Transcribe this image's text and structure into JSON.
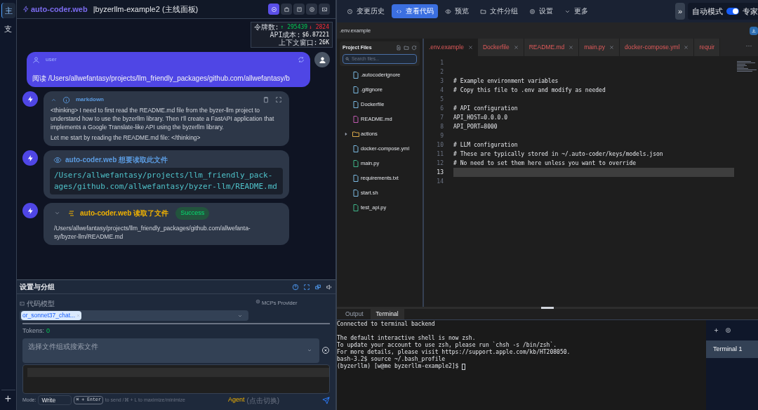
{
  "rail": {
    "items": [
      {
        "label": "主",
        "selected": true
      },
      {
        "label": "支",
        "selected": false
      }
    ],
    "add": "+"
  },
  "header": {
    "brand": "auto-coder.web",
    "project": "|byzerllm-example2 (主线面板)",
    "buttons": [
      {
        "selected": true
      },
      {
        "selected": false
      },
      {
        "selected": false
      },
      {
        "selected": false
      },
      {
        "selected": false
      }
    ]
  },
  "stats": {
    "tokens_label": "令牌数:",
    "tokens_up": "↑ 295439",
    "tokens_down": "↓ 2824",
    "cost_label": "API成本:",
    "cost": "$6.87221",
    "context_label": "上下文窗口:",
    "context": "26K"
  },
  "messages": [
    {
      "kind": "user",
      "role": "user",
      "text": "阅读 /Users/allwefantasy/projects/llm_friendly_packages/github.com/allwefantasy/b"
    },
    {
      "kind": "markdown",
      "label": "markdown",
      "expanded": true,
      "paragraphs": [
        "<thinking> I need to first read the README.md file from the byzer-llm project to understand how to use the byzerllm library. Then I'll create a FastAPI application that implements a Google Translate-like API using the byzerllm library.",
        "Let me start by reading the README.md file: </thinking>"
      ]
    },
    {
      "kind": "read_request",
      "title": "auto-coder.web 想要读取此文件",
      "path_lines": [
        "/Users/allwefantasy/projects/llm_friendly_pack-",
        "ages/github.com/allwefantasy/byzer-llm/README.md"
      ]
    },
    {
      "kind": "read_result",
      "expanded": false,
      "title": "auto-coder.web 读取了文件",
      "status": "Success",
      "path_lines": [
        "/Users/allwefantasy/projects/llm_friendly_packages/github.com/allwefanta-",
        "sy/byzer-llm/README.md"
      ]
    }
  ],
  "settings": {
    "title": "设置与分组",
    "model_label": "代码模型",
    "model_tag": "or_sonnet37_chat...",
    "mcp_label": "MCPs Provider",
    "tokens_label": "Tokens:",
    "tokens": "0",
    "files_placeholder": "选择文件组或搜索文件",
    "mode_label": "Mode:",
    "mode": "Write",
    "shortcut": "⌘ + Enter",
    "shortcut_hint": "to send /⌘ + L to maximize/minimize",
    "agent": "Agent",
    "agent_hint": "(点击切换)"
  },
  "nav": {
    "tabs": [
      {
        "label": "变更历史",
        "selected": false
      },
      {
        "label": "查看代码",
        "selected": true
      },
      {
        "label": "预览",
        "selected": false
      },
      {
        "label": "文件分组",
        "selected": false
      },
      {
        "label": "设置",
        "selected": false
      },
      {
        "label": "更多",
        "selected": false
      }
    ],
    "expand": "»",
    "auto_mode_label": "自动模式",
    "auto_mode_on": true,
    "expert_label": "专家"
  },
  "path_bar": ".env.example",
  "project_files": {
    "title": "Project Files",
    "search_placeholder": "Search files...",
    "items": [
      {
        "kind": "file",
        "name": ".autocoderignore",
        "color": "#7ab8e0"
      },
      {
        "kind": "file",
        "name": ".gitignore",
        "color": "#7ab8e0"
      },
      {
        "kind": "file",
        "name": "Dockerfile",
        "color": "#7ab8e0"
      },
      {
        "kind": "file",
        "name": "README.md",
        "color": "#c05ab0"
      },
      {
        "kind": "folder",
        "name": "actions",
        "color": "#d8a84a",
        "expanded": false
      },
      {
        "kind": "file",
        "name": "docker-compose.yml",
        "color": "#7ab8e0"
      },
      {
        "kind": "file",
        "name": "main.py",
        "color": "#3fb58a"
      },
      {
        "kind": "file",
        "name": "requirements.txt",
        "color": "#7ab8e0"
      },
      {
        "kind": "file",
        "name": "start.sh",
        "color": "#7ab8e0"
      },
      {
        "kind": "file",
        "name": "test_api.py",
        "color": "#3fb58a"
      }
    ]
  },
  "editor": {
    "tabs": [
      {
        "label": ".env.example",
        "selected": true
      },
      {
        "label": "Dockerfile",
        "selected": false
      },
      {
        "label": "README.md",
        "selected": false
      },
      {
        "label": "main.py",
        "selected": false
      },
      {
        "label": "docker-compose.yml",
        "selected": false
      },
      {
        "label": "requir",
        "selected": false
      }
    ],
    "more": "···",
    "lines": [
      {
        "number": "1",
        "selected": false
      },
      {
        "number": "2",
        "selected": false
      },
      {
        "number": "3",
        "text": "# Example environment variables",
        "selected": false
      },
      {
        "number": "4",
        "text": "# Copy this file to .env and modify as needed",
        "selected": false
      },
      {
        "number": "5",
        "selected": false
      },
      {
        "number": "6",
        "text": "# API configuration",
        "selected": false
      },
      {
        "number": "7",
        "text": "API_HOST=0.0.0.0",
        "selected": false
      },
      {
        "number": "8",
        "text": "API_PORT=8000",
        "selected": false
      },
      {
        "number": "9",
        "selected": false
      },
      {
        "number": "10",
        "text": "# LLM configuration",
        "selected": false
      },
      {
        "number": "11",
        "text": "# These are typically stored in ~/.auto-coder/keys/models.json",
        "selected": false
      },
      {
        "number": "12",
        "text": "# No need to set them here unless you want to override",
        "selected": false
      },
      {
        "number": "13",
        "selected": true
      },
      {
        "number": "14",
        "selected": false
      }
    ]
  },
  "terminal": {
    "tabs": [
      {
        "label": "Output",
        "selected": false
      },
      {
        "label": "Terminal",
        "selected": true
      }
    ],
    "blocks": [
      [
        "Connected to terminal backend"
      ],
      [
        "The default interactive shell is now zsh.",
        "To update your account to use zsh, please run `chsh -s /bin/zsh`.",
        "For more details, please visit https://support.apple.com/kb/HT208050.",
        "bash-3.2$ source ~/.bash_profile",
        "(byzerllm) [w@me byzerllm-example2]$"
      ]
    ],
    "sessions": [
      {
        "label": "Terminal 1",
        "selected": true
      }
    ]
  }
}
